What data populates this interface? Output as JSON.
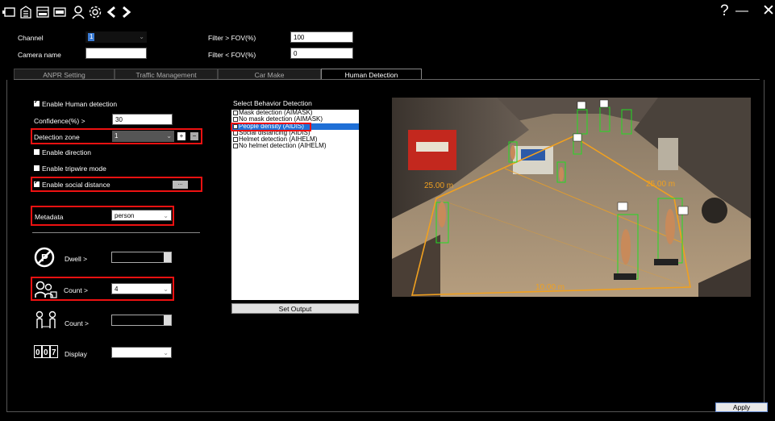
{
  "toolbar": {
    "icons": [
      "monitor-icon",
      "building-icon",
      "anpr-icon",
      "vehicle-plate-icon",
      "person-icon",
      "gear-icon",
      "chevron-left-icon",
      "chevron-right-icon"
    ],
    "help": "?",
    "minimize": "—",
    "close": "✕"
  },
  "header": {
    "channel_label": "Channel",
    "channel_value": "1",
    "camera_name_label": "Camera name",
    "camera_name_value": "",
    "filter_gt_label": "Filter > FOV(%)",
    "filter_gt_value": "100",
    "filter_lt_label": "Filter < FOV(%)",
    "filter_lt_value": "0"
  },
  "tabs": [
    {
      "label": "ANPR Setting"
    },
    {
      "label": "Traffic Management"
    },
    {
      "label": "Car Make"
    },
    {
      "label": "Human Detection",
      "active": true
    }
  ],
  "settings": {
    "enable_human": "Enable Human detection",
    "confidence_label": "Confidence(%) >",
    "confidence_value": "30",
    "zone_label": "Detection zone",
    "zone_value": "1",
    "zone_add": "+",
    "zone_remove": "−",
    "enable_direction": "Enable direction",
    "enable_tripwire": "Enable tripwire mode",
    "enable_social": "Enable social distance",
    "social_btn": "...",
    "metadata_label": "Metadata",
    "metadata_value": "person",
    "dwell_label": "Dwell >",
    "dwell_value": "",
    "count1_label": "Count >",
    "count1_value": "4",
    "count2_label": "Count >",
    "count2_value": "",
    "display_label": "Display",
    "display_value": ""
  },
  "behavior": {
    "title": "Select Behavior Detection",
    "items": [
      {
        "label": "Mask detection (AIMASK)",
        "checked": false,
        "selected": false
      },
      {
        "label": "No mask detection (AIMASK)",
        "checked": false,
        "selected": false
      },
      {
        "label": "People density (AIDIS)",
        "checked": true,
        "selected": true
      },
      {
        "label": "Social distancing (AIDIS)",
        "checked": false,
        "selected": false
      },
      {
        "label": "Helmet detection (AIHELM)",
        "checked": false,
        "selected": false
      },
      {
        "label": "No helmet detection (AIHELM)",
        "checked": false,
        "selected": false
      }
    ],
    "set_output": "Set Output"
  },
  "camera": {
    "measure_left": "25.00 m",
    "measure_right": "25.00 m",
    "measure_bottom": "10.00 m"
  },
  "footer": {
    "apply": "Apply"
  },
  "colors": {
    "highlight_red": "#ee1111",
    "selection_blue": "#1f6fd6",
    "zone_orange": "#f0a020",
    "detect_green": "#22dd22"
  }
}
